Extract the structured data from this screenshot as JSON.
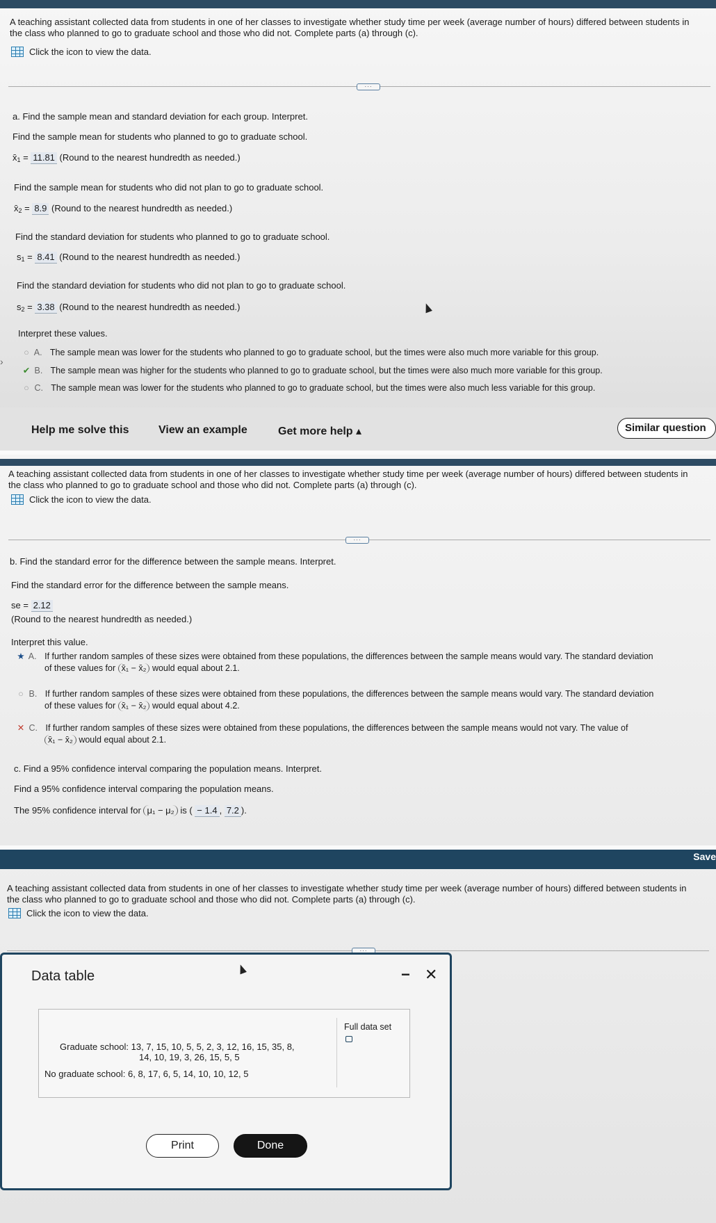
{
  "question_text": "A teaching assistant collected data from students in one of her classes to investigate whether study time per week (average number of hours) differed between students in the class who planned to go to graduate school and those who did not. Complete parts (a) through (c).",
  "data_link": "Click the icon to view the data.",
  "part_a": {
    "heading": "a. Find the sample mean and standard deviation for each group. Interpret.",
    "q1": "Find the sample mean for students who planned to go to graduate school.",
    "x1_label": "x̄",
    "x1_sub": "1",
    "x1_value": "11.81",
    "round_note": "(Round to the nearest hundredth as needed.)",
    "q2": "Find the sample mean for students who did not plan to go to graduate school.",
    "x2_label": "x̄",
    "x2_sub": "2",
    "x2_value": "8.9",
    "q3": "Find the standard deviation for students who planned to go to graduate school.",
    "s1_label": "s",
    "s1_sub": "1",
    "s1_value": "8.41",
    "q4": "Find the standard deviation for students who did not plan to go to graduate school.",
    "s2_label": "s",
    "s2_sub": "2",
    "s2_value": "3.38",
    "interpret": "Interpret these values.",
    "options": [
      {
        "letter": "A.",
        "text": "The sample mean was lower for the students who planned to go to graduate school, but the times were also much more variable for this group."
      },
      {
        "letter": "B.",
        "text": "The sample mean was higher for the students who planned to go to graduate school, but the times were also much more variable for this group."
      },
      {
        "letter": "C.",
        "text": "The sample mean was lower for the students who planned to go to graduate school, but the times were also much less variable for this group."
      }
    ]
  },
  "footer": {
    "help": "Help me solve this",
    "example": "View an example",
    "more_help": "Get more help ▴",
    "similar": "Similar question"
  },
  "part_b": {
    "heading": "b. Find the standard error for the difference between the sample means. Interpret.",
    "q1": "Find the standard error for the difference between the sample means.",
    "se_label": "se =",
    "se_value": "2.12",
    "round_note": "(Round to the nearest hundredth as needed.)",
    "interpret": "Interpret this value.",
    "options": [
      {
        "letter": "A.",
        "line1": "If further random samples of these sizes were obtained from these populations, the differences between the sample means would vary. The standard deviation",
        "pre": "of these values for",
        "post": "would equal about 2.1."
      },
      {
        "letter": "B.",
        "line1": "If further random samples of these sizes were obtained from these populations, the differences between the sample means would vary. The standard deviation",
        "pre": "of these values for",
        "post": "would equal about 4.2."
      },
      {
        "letter": "C.",
        "line1": "If further random samples of these sizes were obtained from these populations, the differences between the sample means would not vary. The value of",
        "pre": "",
        "post": "would equal about 2.1."
      }
    ],
    "diff_expr": "x̄₁ − x̄₂"
  },
  "part_c": {
    "heading": "c. Find a 95% confidence interval comparing the population means. Interpret.",
    "q1": "Find a 95% confidence interval comparing the population means.",
    "ci_pre": "The 95% confidence interval for",
    "ci_expr": "μ₁ − μ₂",
    "ci_is": "is (",
    "ci_low": "− 1.4",
    "ci_sep": ",",
    "ci_high": "7.2",
    "ci_end": ")."
  },
  "save_label": "Save",
  "data_table": {
    "title": "Data table",
    "minimize": "−",
    "close": "✕",
    "full_set": "Full data set",
    "grad_label": "Graduate school:",
    "grad_line1": "13, 7, 15, 10, 5, 5, 2, 3, 12, 16, 15, 35, 8,",
    "grad_line2": "14, 10, 19, 3, 26, 15, 5, 5",
    "nograd_label": "No graduate school:",
    "nograd_values": "6, 8, 17, 6, 5, 14, 10, 10, 12, 5",
    "print": "Print",
    "done": "Done"
  },
  "colors": {
    "header_bar": "#2d4b63",
    "answer_bg": "#e3e8ef",
    "check": "#3a8a2d",
    "cross": "#c0392b"
  }
}
